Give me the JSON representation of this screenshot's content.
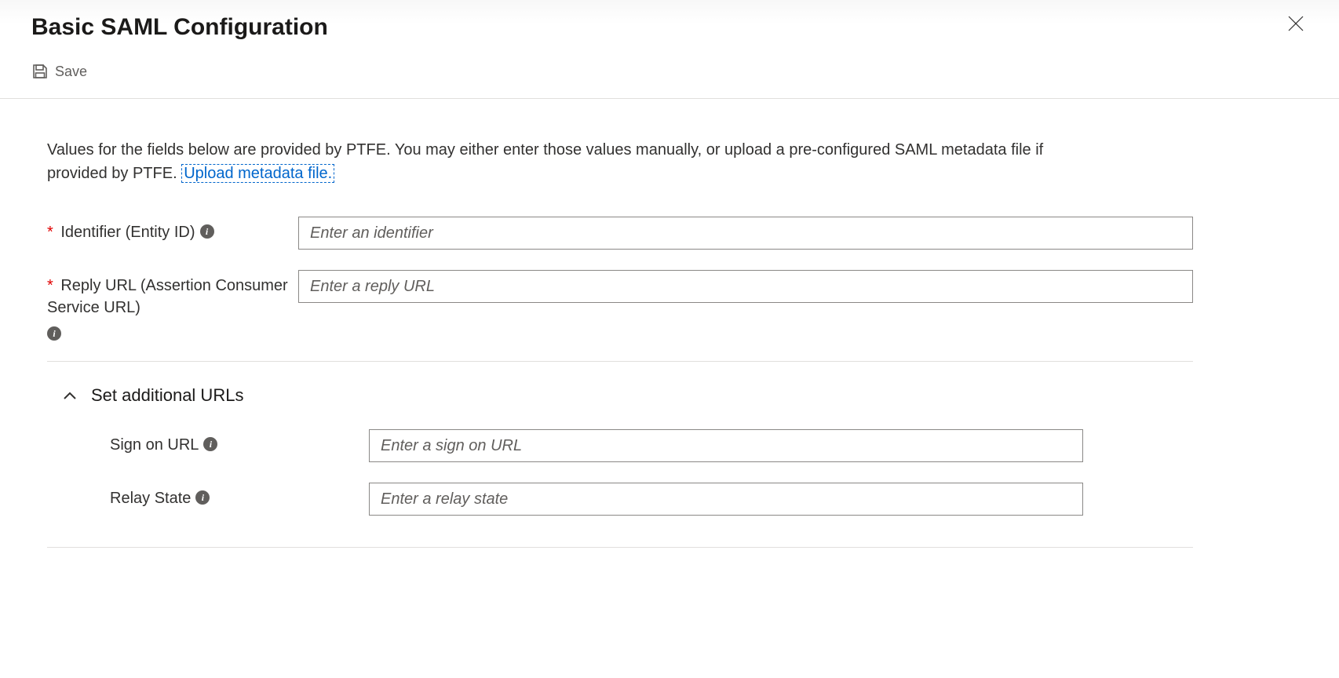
{
  "header": {
    "title": "Basic SAML Configuration"
  },
  "toolbar": {
    "save_label": "Save"
  },
  "main": {
    "description_prefix": "Values for the fields below are provided by PTFE. You may either enter those values manually, or upload a pre-configured SAML metadata file if provided by PTFE. ",
    "upload_link_text": "Upload metadata file.",
    "fields": {
      "identifier": {
        "label": "Identifier (Entity ID)",
        "placeholder": "Enter an identifier",
        "required": true
      },
      "reply_url": {
        "label": "Reply URL (Assertion Consumer Service URL)",
        "placeholder": "Enter a reply URL",
        "required": true
      }
    },
    "additional_section": {
      "title": "Set additional URLs",
      "expanded": true,
      "fields": {
        "sign_on_url": {
          "label": "Sign on URL",
          "placeholder": "Enter a sign on URL"
        },
        "relay_state": {
          "label": "Relay State",
          "placeholder": "Enter a relay state"
        }
      }
    }
  }
}
